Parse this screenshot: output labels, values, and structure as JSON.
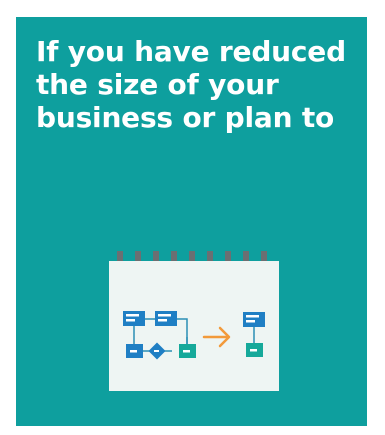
{
  "card": {
    "headline": "If you have reduced the size of your business or plan to",
    "background_color": "#0e9f9e"
  },
  "illustration": {
    "icon": "calendar-flowchart-icon",
    "paper_color": "#eef5f3",
    "ring_color": "#6b6f72",
    "box_blue": "#1f7fc4",
    "box_teal": "#16a99a",
    "arrow_color": "#f29a3a"
  }
}
